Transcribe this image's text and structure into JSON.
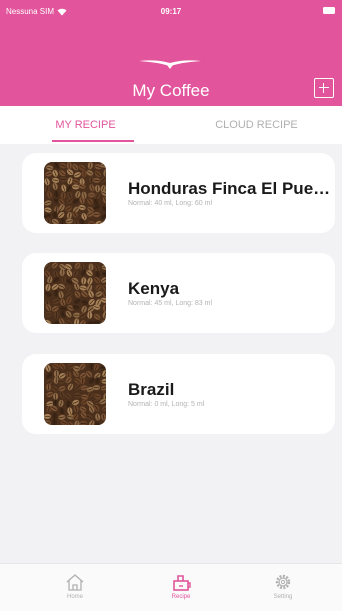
{
  "status_bar": {
    "carrier": "Nessuna SIM",
    "time": "09:17"
  },
  "header": {
    "title": "My Coffee"
  },
  "tabs": [
    {
      "label": "MY RECIPE",
      "active": true
    },
    {
      "label": "CLOUD RECIPE",
      "active": false
    }
  ],
  "recipes": [
    {
      "name": "Honduras Finca El Puente",
      "detail": "Normal: 40 ml, Long: 60 ml"
    },
    {
      "name": "Kenya",
      "detail": "Normal: 45 ml, Long: 83 ml"
    },
    {
      "name": "Brazil",
      "detail": "Normal: 0 ml, Long: 5 ml"
    }
  ],
  "tab_bar": [
    {
      "label": "Home",
      "icon": "home-icon",
      "active": false
    },
    {
      "label": "Recipe",
      "icon": "coffee-machine-icon",
      "active": true
    },
    {
      "label": "Setting",
      "icon": "gear-icon",
      "active": false
    }
  ],
  "colors": {
    "accent": "#e2559c",
    "background": "#f2f2f4",
    "card": "#ffffff",
    "inactive": "#b0b0b0"
  }
}
